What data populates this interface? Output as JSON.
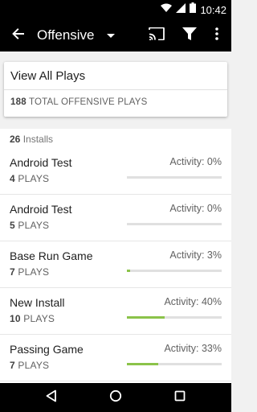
{
  "status_bar": {
    "time": "10:42",
    "icons": [
      "wifi-icon",
      "signal-icon",
      "battery-icon"
    ]
  },
  "app_bar": {
    "title": "Offensive",
    "icons": [
      "back-arrow-icon",
      "dropdown-arrow-icon",
      "cast-icon",
      "filter-icon",
      "more-vert-icon"
    ]
  },
  "summary": {
    "view_all_label": "View All Plays",
    "total_count": "188",
    "total_label": "TOTAL OFFENSIVE PLAYS"
  },
  "installs": {
    "count": "26",
    "label": "Installs",
    "items": [
      {
        "name": "Android Test",
        "plays_count": "4",
        "plays_label": "PLAYS",
        "activity_text": "Activity: 0%",
        "activity_fraction": 0.0
      },
      {
        "name": "Android Test",
        "plays_count": "5",
        "plays_label": "PLAYS",
        "activity_text": "Activity: 0%",
        "activity_fraction": 0.0
      },
      {
        "name": "Base Run Game",
        "plays_count": "7",
        "plays_label": "PLAYS",
        "activity_text": "Activity: 3%",
        "activity_fraction": 0.03
      },
      {
        "name": "New Install",
        "plays_count": "10",
        "plays_label": "PLAYS",
        "activity_text": "Activity: 40%",
        "activity_fraction": 0.4
      },
      {
        "name": "Passing Game",
        "plays_count": "7",
        "plays_label": "PLAYS",
        "activity_text": "Activity: 33%",
        "activity_fraction": 0.33
      }
    ]
  },
  "nav_bar": {
    "icons": [
      "nav-back-icon",
      "nav-home-icon",
      "nav-recents-icon"
    ]
  },
  "colors": {
    "app_bar": "#000000",
    "progress_fill": "#8bc34a",
    "progress_track": "#e0e0e0"
  }
}
